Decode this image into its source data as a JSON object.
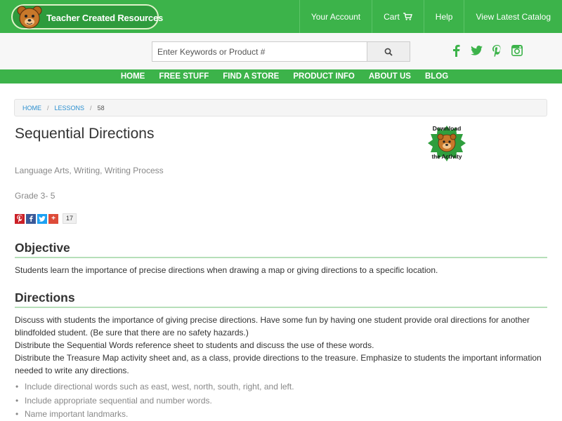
{
  "header": {
    "logo_text": "Teacher Created Resources",
    "nav": [
      {
        "label": "Your Account"
      },
      {
        "label": "Cart"
      },
      {
        "label": "Help"
      },
      {
        "label": "View Latest Catalog"
      }
    ]
  },
  "search": {
    "placeholder": "Enter Keywords or Product #",
    "button_icon": "search-icon"
  },
  "social_icons": [
    "facebook-icon",
    "twitter-icon",
    "pinterest-icon",
    "instagram-icon"
  ],
  "main_nav": [
    {
      "label": "HOME"
    },
    {
      "label": "FREE STUFF"
    },
    {
      "label": "FIND A STORE"
    },
    {
      "label": "PRODUCT INFO"
    },
    {
      "label": "ABOUT US"
    },
    {
      "label": "BLOG"
    }
  ],
  "breadcrumb": {
    "items": [
      "HOME",
      "LESSONS"
    ],
    "current": "58"
  },
  "lesson": {
    "title": "Sequential Directions",
    "download_badge": {
      "line1": "Download",
      "line2": "the Activity"
    },
    "subjects": "Language Arts, Writing, Writing Process",
    "grade": "Grade 3- 5",
    "share_count": "17",
    "objective_heading": "Objective",
    "objective_text": "Students learn the importance of precise directions when drawing a map or giving directions to a specific location.",
    "directions_heading": "Directions",
    "directions_paragraphs": [
      "Discuss with students the importance of giving precise directions. Have some fun by having one student provide oral directions for another blindfolded student. (Be sure that there are no safety hazards.)",
      "Distribute the Sequential Words reference sheet to students and discuss the use of these words.",
      "Distribute the Treasure Map activity sheet and, as a class, provide directions to the treasure. Emphasize to students the important information needed to write any directions."
    ],
    "directions_bullets": [
      "Include directional words such as east, west, north, south, right, and left.",
      "Include appropriate sequential and number words.",
      "Name important landmarks."
    ]
  },
  "colors": {
    "brand_green": "#3cb34a",
    "link_blue": "#2a8fd0",
    "pinterest": "#cb2027",
    "facebook": "#3b5998",
    "twitter": "#1da1f2",
    "googleplus": "#dd4b39"
  }
}
